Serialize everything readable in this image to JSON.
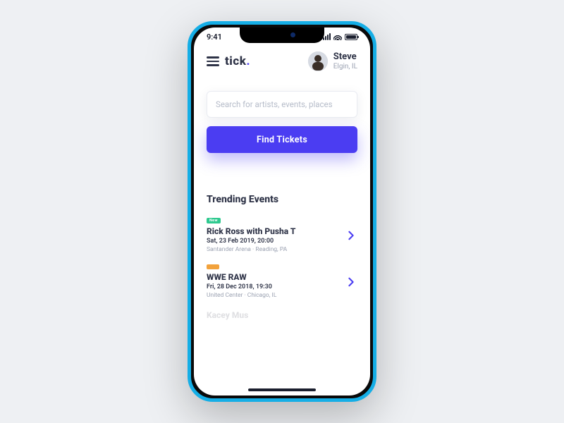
{
  "status": {
    "time": "9:41"
  },
  "brand": {
    "name": "tick",
    "dot": "."
  },
  "user": {
    "name": "Steve",
    "location": "Elgin, IL"
  },
  "search": {
    "placeholder": "Search for artists, events, places"
  },
  "cta": {
    "label": "Find Tickets"
  },
  "section": {
    "trending": "Trending Events"
  },
  "tags": {
    "new": "New",
    "hot": ""
  },
  "colors": {
    "accent": "#4b3df2",
    "tag_new": "#2fc98f",
    "tag_hot": "#f2a23c"
  },
  "events": [
    {
      "tagKey": "new",
      "title": "Rick Ross with Pusha T",
      "date": "Sat, 23 Feb 2019, 20:00",
      "location": "Santander Arena · Reading, PA"
    },
    {
      "tagKey": "hot",
      "title": "WWE RAW",
      "date": "Fri, 28 Dec 2018, 19:30",
      "location": "United Center · Chicago, IL"
    },
    {
      "tagKey": "",
      "title": "Kacey Mus",
      "date": "",
      "location": ""
    }
  ]
}
